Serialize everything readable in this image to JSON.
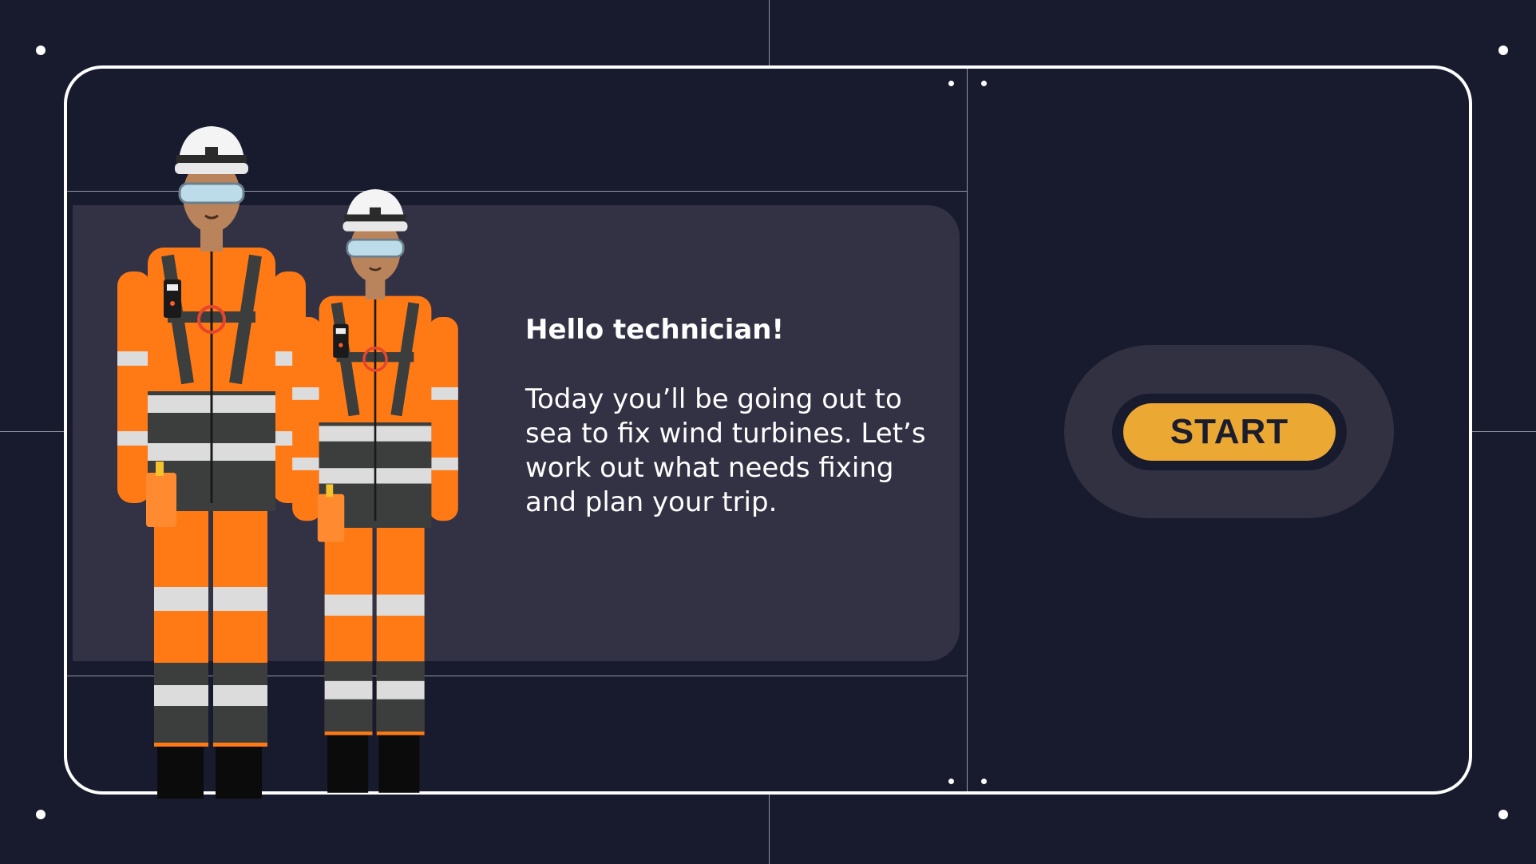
{
  "intro": {
    "greeting": "Hello technician!",
    "message": "Today you’ll be going out to sea to fix wind turbines. Let’s work out what needs fixing and plan your trip."
  },
  "start_button": {
    "label": "START"
  },
  "colors": {
    "background": "#181a2e",
    "panel": "#333245",
    "accent": "#eba933",
    "hi_vis_orange": "#ff7a14"
  },
  "characters": [
    {
      "name": "technician-man-icon"
    },
    {
      "name": "technician-woman-icon"
    }
  ]
}
